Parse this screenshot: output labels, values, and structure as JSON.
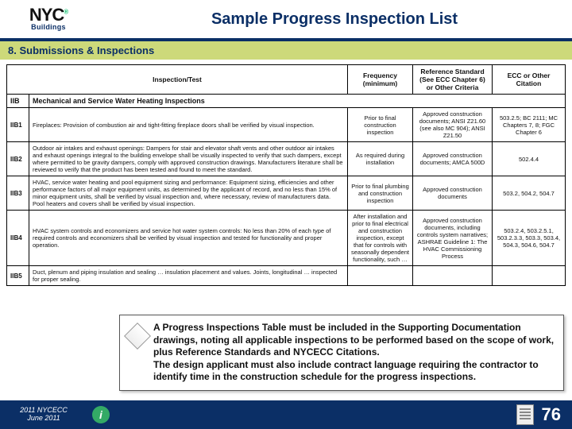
{
  "header": {
    "logo_top": "NYC",
    "logo_bottom": "Buildings",
    "title": "Sample Progress Inspection List"
  },
  "section_bar": "8. Submissions & Inspections",
  "columns": {
    "inspection": "Inspection/Test",
    "frequency": "Frequency (minimum)",
    "reference": "Reference Standard (See ECC Chapter 6) or Other Criteria",
    "citation": "ECC or Other Citation"
  },
  "group": {
    "id": "IIB",
    "label": "Mechanical and Service Water Heating Inspections"
  },
  "rows": [
    {
      "id": "IIB1",
      "desc": "Fireplaces: Provision of combustion air and tight-fitting fireplace doors shall be verified by visual inspection.",
      "freq": "Prior to final construction inspection",
      "ref": "Approved construction documents; ANSI Z21.60 (see also MC 904); ANSI Z21.50",
      "cite": "503.2.5; BC 2111; MC Chapters 7, 8; FGC Chapter 6"
    },
    {
      "id": "IIB2",
      "desc": "Outdoor air intakes and exhaust openings: Dampers for stair and elevator shaft vents and other outdoor air intakes and exhaust openings integral to the building envelope shall be visually inspected to verify that such dampers, except where permitted to be gravity dampers, comply with approved construction drawings. Manufacturers literature shall be reviewed to verify that the product has been tested and found to meet the standard.",
      "freq": "As required during installation",
      "ref": "Approved construction documents; AMCA 500D",
      "cite": "502.4.4"
    },
    {
      "id": "IIB3",
      "desc": "HVAC, service water heating and pool equipment sizing and performance: Equipment sizing, efficiencies and other performance factors of all major equipment units, as determined by the applicant of record, and no less than 15% of minor equipment units, shall be verified by visual inspection and, where necessary, review of manufacturers data. Pool heaters and covers shall be verified by visual inspection.",
      "freq": "Prior to final plumbing and construction inspection",
      "ref": "Approved construction documents",
      "cite": "503.2, 504.2, 504.7"
    },
    {
      "id": "IIB4",
      "desc": "HVAC system controls and economizers and service hot water system controls: No less than 20% of each type of required controls and economizers shall be verified by visual inspection and tested for functionality and proper operation.",
      "freq": "After installation and prior to final electrical and construction inspection, except that for controls with seasonally dependent functionality, such …",
      "ref": "Approved construction documents, including controls system narratives; ASHRAE Guideline 1: The HVAC Commissioning Process",
      "cite": "503.2.4, 503.2.5.1, 503.2.3.3, 503.3, 503.4, 504.3, 504.6, 504.7"
    },
    {
      "id": "IIB5",
      "desc": "Duct, plenum and piping insulation and sealing … insulation placement and values. Joints, longitudinal … inspected for proper sealing.",
      "freq": "",
      "ref": "",
      "cite": ""
    }
  ],
  "callout": "A Progress Inspections Table must be included in the Supporting Documentation drawings, noting all applicable inspections to be performed based on the scope of work, plus Reference Standards and NYCECC Citations.\nThe design applicant must also include contract language requiring the contractor to identify time in the construction schedule for the progress inspections.",
  "footer": {
    "date_line1": "2011 NYCECC",
    "date_line2": "June 2011",
    "page": "76"
  }
}
